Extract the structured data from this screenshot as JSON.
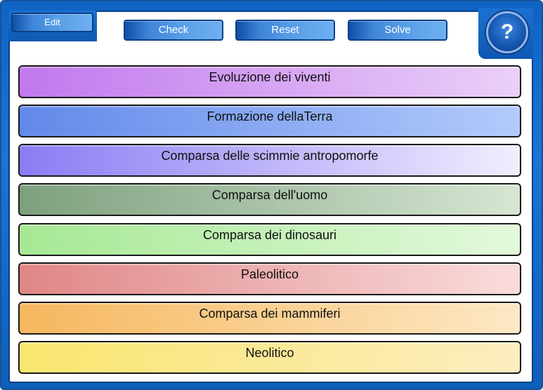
{
  "toolbar": {
    "edit_label": "Edit",
    "check_label": "Check",
    "reset_label": "Reset",
    "solve_label": "Solve",
    "help_label": "?"
  },
  "items": [
    {
      "label": "Evoluzione dei viventi",
      "color_from": "#c178ee",
      "color_to": "#ead0f8"
    },
    {
      "label": "Formazione dellaTerra",
      "color_from": "#6289ea",
      "color_to": "#b3cbfb"
    },
    {
      "label": "Comparsa delle scimmie antropomorfe",
      "color_from": "#8a7cf4",
      "color_to": "#f1eefe"
    },
    {
      "label": "Comparsa dell'uomo",
      "color_from": "#7ea07e",
      "color_to": "#d6e6d2"
    },
    {
      "label": "Comparsa dei dinosauri",
      "color_from": "#a6e894",
      "color_to": "#e3f9dc"
    },
    {
      "label": "Paleolitico",
      "color_from": "#e08686",
      "color_to": "#fadcdc"
    },
    {
      "label": "Comparsa dei mammiferi",
      "color_from": "#f6b75e",
      "color_to": "#fde8c4"
    },
    {
      "label": "Neolitico",
      "color_from": "#f8e66e",
      "color_to": "#fdedc0"
    }
  ]
}
